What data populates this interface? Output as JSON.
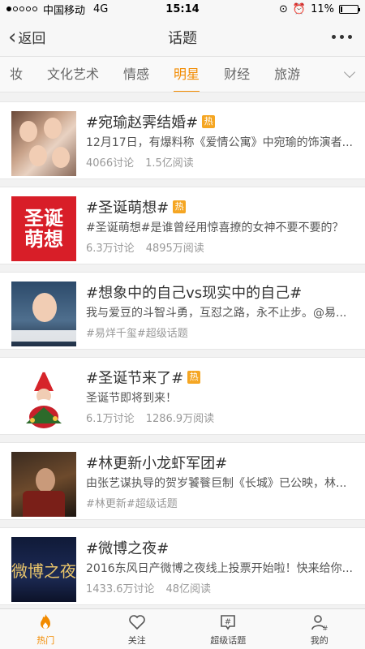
{
  "status": {
    "carrier": "中国移动",
    "network": "4G",
    "time": "15:14",
    "battery": "11%",
    "battery_level": 0.11
  },
  "nav": {
    "back_label": "返回",
    "title": "话题"
  },
  "tabs": [
    {
      "label": "妆"
    },
    {
      "label": "文化艺术"
    },
    {
      "label": "情感"
    },
    {
      "label": "明星"
    },
    {
      "label": "财经"
    },
    {
      "label": "旅游"
    }
  ],
  "hot_badge": "热",
  "topics": [
    {
      "title": "#宛瑜赵霁结婚#",
      "hot": true,
      "desc": "12月17日，有爆料称《爱情公寓》中宛瑜的饰演者...",
      "stat1": "4066讨论",
      "stat2": "1.5亿阅读"
    },
    {
      "title": "#圣诞萌想#",
      "hot": true,
      "desc": "#圣诞萌想#是谁曾经用惊喜撩的女神不要不要的？",
      "stat1": "6.3万讨论",
      "stat2": "4895万阅读",
      "thumb_text": "圣诞萌想"
    },
    {
      "title": "#想象中的自己vs现实中的自己#",
      "hot": false,
      "desc": "我与爱豆的斗智斗勇，互怼之路，永不止步。@易...",
      "stat1": "#易烊千玺#超级话题",
      "stat2": ""
    },
    {
      "title": "#圣诞节来了#",
      "hot": true,
      "desc": "圣诞节即将到来！",
      "stat1": "6.1万讨论",
      "stat2": "1286.9万阅读"
    },
    {
      "title": "#林更新小龙虾军团#",
      "hot": false,
      "desc": "由张艺谋执导的贺岁饕餮巨制《长城》已公映，林...",
      "stat1": "#林更新#超级话题",
      "stat2": ""
    },
    {
      "title": "#微博之夜#",
      "hot": false,
      "desc": "2016东风日产微博之夜线上投票开始啦！快来给你...",
      "stat1": "1433.6万讨论",
      "stat2": "48亿阅读",
      "thumb_text": "微博之夜"
    }
  ],
  "tabbar": [
    {
      "label": "热门",
      "icon": "flame-icon"
    },
    {
      "label": "关注",
      "icon": "heart-icon"
    },
    {
      "label": "超级话题",
      "icon": "super-topic-icon"
    },
    {
      "label": "我的",
      "icon": "user-icon"
    }
  ],
  "colors": {
    "accent": "#f28b00",
    "hot_badge": "#f5a623"
  }
}
